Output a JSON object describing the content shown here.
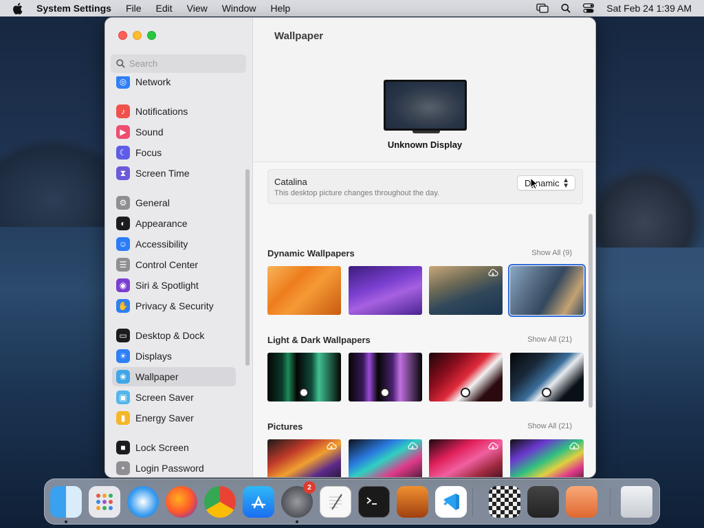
{
  "menubar": {
    "app_name": "System Settings",
    "items": [
      "File",
      "Edit",
      "View",
      "Window",
      "Help"
    ],
    "clock": "Sat Feb 24  1:39 AM"
  },
  "sidebar": {
    "search_placeholder": "Search",
    "items": [
      {
        "label": "Network",
        "icon": "globe-icon",
        "color": "#2f7ff5"
      },
      {
        "label": "Notifications",
        "icon": "bell-icon",
        "color": "#f0514a"
      },
      {
        "label": "Sound",
        "icon": "speaker-icon",
        "color": "#ee4d6e"
      },
      {
        "label": "Focus",
        "icon": "moon-icon",
        "color": "#5e5ce6"
      },
      {
        "label": "Screen Time",
        "icon": "hourglass-icon",
        "color": "#6b5ad9"
      },
      {
        "label": "General",
        "icon": "gear-icon",
        "color": "#8e8e93"
      },
      {
        "label": "Appearance",
        "icon": "appearance-icon",
        "color": "#1c1c1e"
      },
      {
        "label": "Accessibility",
        "icon": "accessibility-icon",
        "color": "#2c7cf6"
      },
      {
        "label": "Control Center",
        "icon": "control-center-icon",
        "color": "#8e8e93"
      },
      {
        "label": "Siri & Spotlight",
        "icon": "siri-icon",
        "color": "#7a3fd1"
      },
      {
        "label": "Privacy & Security",
        "icon": "hand-icon",
        "color": "#2f7ff5"
      },
      {
        "label": "Desktop & Dock",
        "icon": "dock-icon",
        "color": "#1c1c1e"
      },
      {
        "label": "Displays",
        "icon": "sun-icon",
        "color": "#2f7ff5"
      },
      {
        "label": "Wallpaper",
        "icon": "wallpaper-icon",
        "color": "#3fa6e8"
      },
      {
        "label": "Screen Saver",
        "icon": "screen-saver-icon",
        "color": "#52b6e8"
      },
      {
        "label": "Energy Saver",
        "icon": "battery-icon",
        "color": "#f5b629"
      },
      {
        "label": "Lock Screen",
        "icon": "lock-icon",
        "color": "#1c1c1e"
      },
      {
        "label": "Login Password",
        "icon": "password-icon",
        "color": "#8e8e93"
      }
    ]
  },
  "main": {
    "title": "Wallpaper",
    "display_name": "Unknown Display",
    "current": {
      "name": "Catalina",
      "description": "This desktop picture changes throughout the day.",
      "mode": "Dynamic"
    },
    "sections": [
      {
        "title": "Dynamic Wallpapers",
        "show_all": "Show All (9)"
      },
      {
        "title": "Light & Dark Wallpapers",
        "show_all": "Show All (21)"
      },
      {
        "title": "Pictures",
        "show_all": "Show All (21)"
      }
    ]
  },
  "dock": {
    "apps": [
      "finder-icon",
      "launchpad-icon",
      "safari-icon",
      "firefox-icon",
      "chrome-icon",
      "app-store-icon",
      "system-settings-icon",
      "textedit-icon",
      "terminal-icon",
      "garageband-icon",
      "vscode-icon",
      "chess-icon",
      "screenshot-icon",
      "screen-sharing-icon",
      "trash-icon"
    ],
    "settings_badge": "2"
  }
}
